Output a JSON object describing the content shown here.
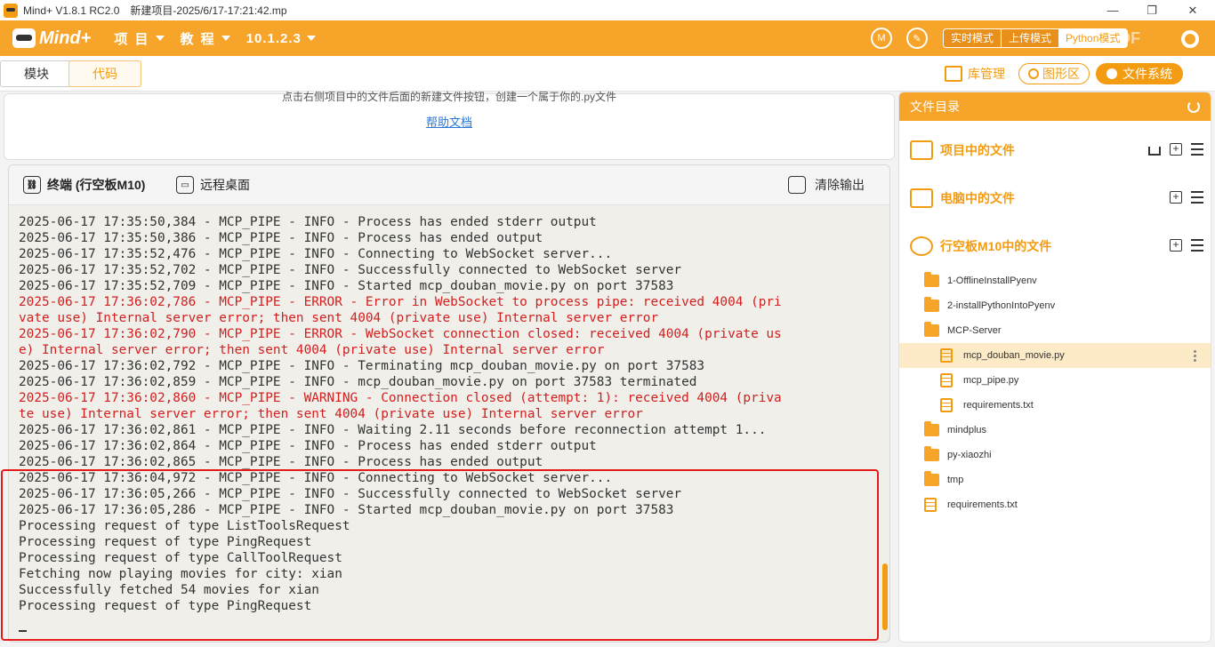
{
  "window": {
    "app_title": "Mind+ V1.8.1 RC2.0",
    "project_title": "新建项目-2025/6/17-17:21:42.mp"
  },
  "topbar": {
    "logo_text": "Mind+",
    "menu": [
      {
        "label": "项 目"
      },
      {
        "label": "教 程"
      },
      {
        "label": "10.1.2.3"
      }
    ],
    "modes": {
      "realtime": "实时模式",
      "upload": "上传模式",
      "python": "Python模式"
    },
    "watermark": "DF"
  },
  "secbar": {
    "tab_blocks": "模块",
    "tab_code": "代码",
    "library": "库管理",
    "shape_area": "图形区",
    "file_system": "文件系统"
  },
  "editor": {
    "hint": "点击右侧项目中的文件后面的新建文件按钮，创建一个属于你的.py文件",
    "help_link": "帮助文档"
  },
  "terminal": {
    "tab_terminal": "终端 (行空板M10)",
    "tab_remote": "远程桌面",
    "clear": "清除输出",
    "lines": [
      {
        "text": "2025-06-17 17:35:50,384 - MCP_PIPE - INFO - Process has ended stderr output",
        "level": "info"
      },
      {
        "text": "2025-06-17 17:35:50,386 - MCP_PIPE - INFO - Process has ended output",
        "level": "info"
      },
      {
        "text": "2025-06-17 17:35:52,476 - MCP_PIPE - INFO - Connecting to WebSocket server...",
        "level": "info"
      },
      {
        "text": "2025-06-17 17:35:52,702 - MCP_PIPE - INFO - Successfully connected to WebSocket server",
        "level": "info"
      },
      {
        "text": "2025-06-17 17:35:52,709 - MCP_PIPE - INFO - Started mcp_douban_movie.py on port 37583",
        "level": "info"
      },
      {
        "text": "2025-06-17 17:36:02,786 - MCP_PIPE - ERROR - Error in WebSocket to process pipe: received 4004 (pri",
        "level": "err"
      },
      {
        "text": "vate use) Internal server error; then sent 4004 (private use) Internal server error",
        "level": "err"
      },
      {
        "text": "2025-06-17 17:36:02,790 - MCP_PIPE - ERROR - WebSocket connection closed: received 4004 (private us",
        "level": "err"
      },
      {
        "text": "e) Internal server error; then sent 4004 (private use) Internal server error",
        "level": "err"
      },
      {
        "text": "2025-06-17 17:36:02,792 - MCP_PIPE - INFO - Terminating mcp_douban_movie.py on port 37583",
        "level": "info"
      },
      {
        "text": "2025-06-17 17:36:02,859 - MCP_PIPE - INFO - mcp_douban_movie.py on port 37583 terminated",
        "level": "info"
      },
      {
        "text": "2025-06-17 17:36:02,860 - MCP_PIPE - WARNING - Connection closed (attempt: 1): received 4004 (priva",
        "level": "err"
      },
      {
        "text": "te use) Internal server error; then sent 4004 (private use) Internal server error",
        "level": "err"
      },
      {
        "text": "2025-06-17 17:36:02,861 - MCP_PIPE - INFO - Waiting 2.11 seconds before reconnection attempt 1...",
        "level": "info"
      },
      {
        "text": "2025-06-17 17:36:02,864 - MCP_PIPE - INFO - Process has ended stderr output",
        "level": "info"
      },
      {
        "text": "2025-06-17 17:36:02,865 - MCP_PIPE - INFO - Process has ended output",
        "level": "info"
      },
      {
        "text": "2025-06-17 17:36:04,972 - MCP_PIPE - INFO - Connecting to WebSocket server...",
        "level": "info"
      },
      {
        "text": "2025-06-17 17:36:05,266 - MCP_PIPE - INFO - Successfully connected to WebSocket server",
        "level": "info"
      },
      {
        "text": "2025-06-17 17:36:05,286 - MCP_PIPE - INFO - Started mcp_douban_movie.py on port 37583",
        "level": "info"
      },
      {
        "text": "Processing request of type ListToolsRequest",
        "level": "info"
      },
      {
        "text": "Processing request of type PingRequest",
        "level": "info"
      },
      {
        "text": "Processing request of type CallToolRequest",
        "level": "info"
      },
      {
        "text": "Fetching now playing movies for city: xian",
        "level": "info"
      },
      {
        "text": "Successfully fetched 54 movies for xian",
        "level": "info"
      },
      {
        "text": "Processing request of type PingRequest",
        "level": "info"
      }
    ]
  },
  "filepanel": {
    "title": "文件目录",
    "sections": {
      "project": "项目中的文件",
      "computer": "电脑中的文件",
      "board": "行空板M10中的文件"
    },
    "tree": [
      {
        "name": "1-OfflineInstallPyenv",
        "type": "folder",
        "depth": 0
      },
      {
        "name": "2-installPythonIntoPyenv",
        "type": "folder",
        "depth": 0
      },
      {
        "name": "MCP-Server",
        "type": "folder-open",
        "depth": 0
      },
      {
        "name": "mcp_douban_movie.py",
        "type": "file",
        "depth": 1,
        "selected": true
      },
      {
        "name": "mcp_pipe.py",
        "type": "file",
        "depth": 1
      },
      {
        "name": "requirements.txt",
        "type": "file",
        "depth": 1
      },
      {
        "name": "mindplus",
        "type": "folder",
        "depth": 0
      },
      {
        "name": "py-xiaozhi",
        "type": "folder",
        "depth": 0
      },
      {
        "name": "tmp",
        "type": "folder",
        "depth": 0
      },
      {
        "name": "requirements.txt",
        "type": "file",
        "depth": 0
      }
    ]
  },
  "colors": {
    "accent": "#f6a52a",
    "error_text": "#d21f1f",
    "highlight_border": "#e51b1b",
    "terminal_bg": "#f0efe9"
  }
}
